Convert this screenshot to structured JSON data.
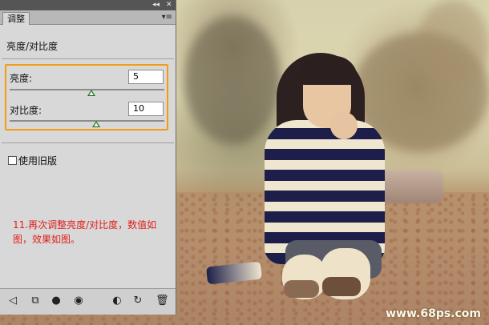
{
  "panel": {
    "tab_label": "调整",
    "collapse_glyph": "◂◂",
    "close_glyph": "✕",
    "menu_glyph": "▾≡",
    "title": "亮度/对比度",
    "brightness": {
      "label": "亮度:",
      "value": "5",
      "fraction": 0.53
    },
    "contrast": {
      "label": "对比度:",
      "value": "10",
      "fraction": 0.56
    },
    "legacy": {
      "label": "使用旧版",
      "checked": false
    },
    "note": "11.再次调整亮度/对比度，数值如图，效果如图。",
    "footer_icons": [
      {
        "name": "back-arrow-icon",
        "glyph": "◁"
      },
      {
        "name": "clip-to-layer-icon",
        "glyph": "⧉"
      },
      {
        "name": "layer-mask-icon",
        "glyph": "●"
      },
      {
        "name": "visibility-eye-icon",
        "glyph": "◉"
      },
      {
        "name": "previous-state-icon",
        "glyph": "◐"
      },
      {
        "name": "reset-icon",
        "glyph": "↻"
      },
      {
        "name": "trash-icon",
        "glyph": "🗑"
      }
    ]
  },
  "watermark": "www.68ps.com",
  "colors": {
    "highlight": "#f29c13",
    "note": "#e0201c"
  }
}
